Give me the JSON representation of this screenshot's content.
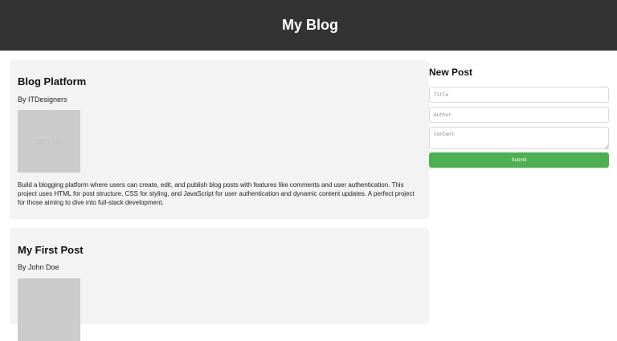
{
  "header": {
    "title": "My Blog",
    "background": "#333333"
  },
  "posts": [
    {
      "title": "Blog Platform",
      "author": "By ITDesigners",
      "image_placeholder": "100 x 100",
      "body": "Build a blogging platform where users can create, edit, and publish blog posts with features like comments and user authentication. This project uses HTML for post structure, CSS for styling, and JavaScript for user authentication and dynamic content updates. A perfect project for those aiming to dive into full-stack development."
    },
    {
      "title": "My First Post",
      "author": "By John Doe"
    }
  ],
  "new_post_form": {
    "heading": "New Post",
    "title_placeholder": "Title",
    "author_placeholder": "Author",
    "content_placeholder": "Content",
    "submit_label": "Submit",
    "submit_color": "#4caf50"
  }
}
